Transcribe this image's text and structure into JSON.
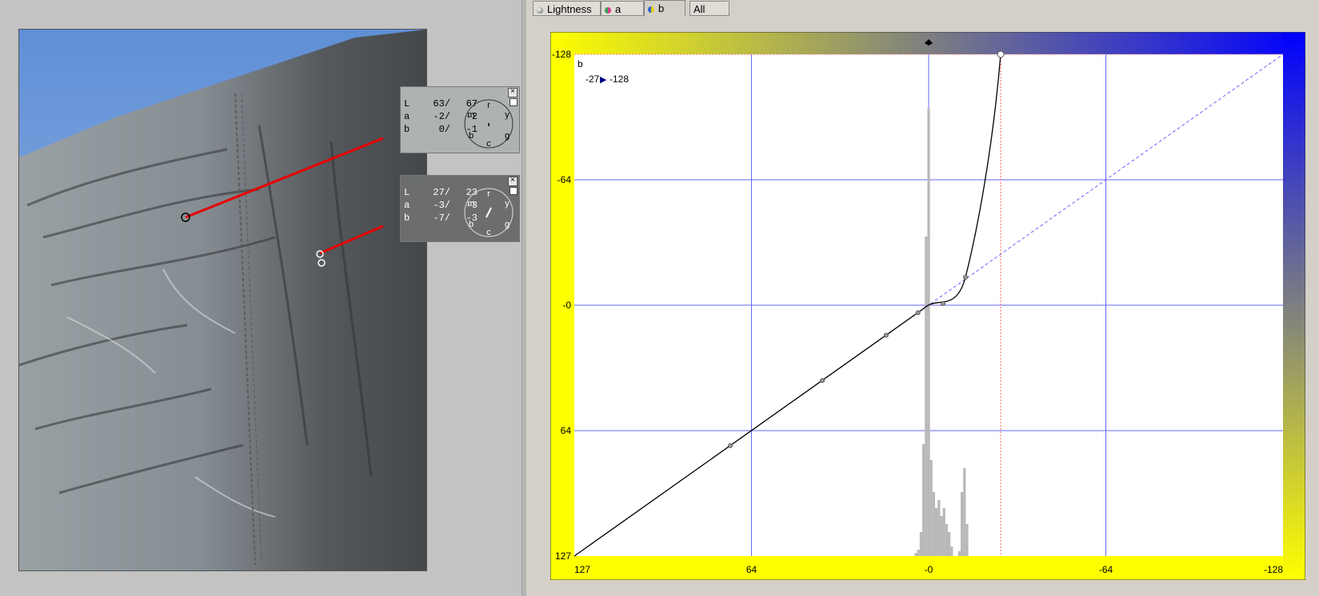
{
  "tabs": [
    {
      "label": "Lightness",
      "icon": "lightness-channel-icon",
      "active": false
    },
    {
      "label": "a",
      "icon": "a-channel-icon",
      "active": false
    },
    {
      "label": "b",
      "icon": "b-channel-icon",
      "active": true
    },
    {
      "label": "All",
      "icon": "",
      "active": false
    }
  ],
  "readout1": {
    "rows": [
      {
        "ch": "L",
        "before": "63/",
        "after": "67"
      },
      {
        "ch": "a",
        "before": "-2/",
        "after": "-2"
      },
      {
        "ch": "b",
        "before": "0/",
        "after": "-1"
      }
    ],
    "close": "×"
  },
  "readout2": {
    "rows": [
      {
        "ch": "L",
        "before": "27/",
        "after": "23"
      },
      {
        "ch": "a",
        "before": "-3/",
        "after": "-3"
      },
      {
        "ch": "b",
        "before": "-7/",
        "after": "-3"
      }
    ],
    "close": "×"
  },
  "dial_letters": {
    "top": "r",
    "left": "m",
    "right": "y",
    "bl": "b",
    "bottom": "c",
    "br": "g"
  },
  "curve": {
    "channel_label": "b",
    "point_in": "-27",
    "point_arrow": "▶",
    "point_out": "-128",
    "y_ticks": [
      "-128",
      "-64",
      "-0",
      "64",
      "127"
    ],
    "x_ticks": [
      "127",
      "64",
      "-0",
      "-64",
      "-128"
    ],
    "colors": {
      "yellow": "#ffff00",
      "blue": "#0000ff",
      "grid": "#6666ff",
      "histogram": "#b8b8b8"
    }
  }
}
